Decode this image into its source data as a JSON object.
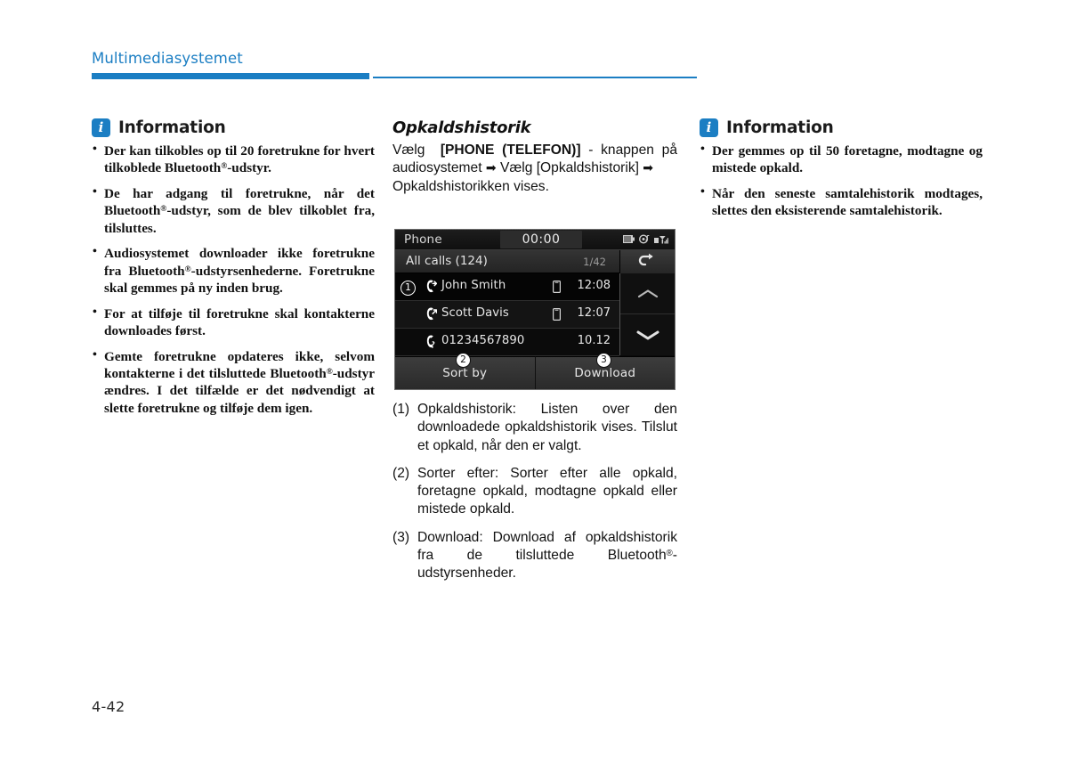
{
  "header": {
    "title": "Multimediasystemet",
    "accent_color": "#1b7ec3"
  },
  "page_number": "4-42",
  "left_column": {
    "info_title": "Information",
    "info_icon": "info-icon",
    "bullets": [
      "Der kan tilkobles op til 20 foretrukne for hvert tilkoblede Bluetooth®-udstyr.",
      "De har adgang til foretrukne, når det Bluetooth®-udstyr, som de blev tilkoblet fra, tilsluttes.",
      "Audiosystemet downloader ikke foretrukne fra Bluetooth®-udstyrsenhederne. Foretrukne skal gemmes på ny inden brug.",
      "For at tilføje til foretrukne skal kontakterne downloades først.",
      "Gemte foretrukne opdateres ikke, selvom kontakterne i det tilsluttede Bluetooth®-udstyr ændres. I det tilfælde er det nødvendigt at slette foretrukne og tilføje dem igen."
    ]
  },
  "middle_column": {
    "section_title": "Opkaldshistorik",
    "intro_line1": "Vælg",
    "intro_button": "[PHONE (TELEFON)]",
    "intro_line2": "- knappen på audiosystemet",
    "arrow": "➡",
    "intro_line3": "Vælg [Opkaldshistorik]",
    "intro_line4": "Opkaldshistorikken vises.",
    "numbered": [
      {
        "label": "(1)",
        "text": "Opkaldshistorik: Listen over den downloadede opkaldshistorik vises. Tilslut et opkald, når den er valgt."
      },
      {
        "label": "(2)",
        "text": "Sorter efter: Sorter efter alle opkald, foretagne opkald, modtagne opkald eller mistede opkald."
      },
      {
        "label": "(3)",
        "text": "Download: Download af opkaldshistorik fra de tilsluttede Bluetooth®-udstyrsenheder."
      }
    ]
  },
  "right_column": {
    "info_title": "Information",
    "info_icon": "info-icon",
    "bullets": [
      "Der gemmes op til 50 foretagne, modtagne og mistede opkald.",
      "Når den seneste samtalehistorik modtages, slettes den eksisterende samtalehistorik."
    ]
  },
  "device_screenshot": {
    "app_name": "Phone",
    "clock": "00:00",
    "status_icons": [
      "battery-icon",
      "audio-icon",
      "signal-icon"
    ],
    "list_title": "All calls (124)",
    "page_index": "1/42",
    "back_icon": "back-arrow-icon",
    "rows": [
      {
        "call_type_icon": "outgoing-call-icon",
        "name": "John Smith",
        "device_icon": "mobile-phone-icon",
        "time": "12:08",
        "selected": true
      },
      {
        "call_type_icon": "outgoing-call-icon",
        "name": "Scott Davis",
        "device_icon": "mobile-phone-icon",
        "time": "12:07",
        "selected": false
      },
      {
        "call_type_icon": "missed-call-icon",
        "name": "01234567890",
        "device_icon": "",
        "time": "10.12",
        "selected": false
      }
    ],
    "scroll_up_icon": "chevron-up-icon",
    "scroll_down_icon": "chevron-down-icon",
    "footer_buttons": [
      {
        "label": "Sort by"
      },
      {
        "label": "Download"
      }
    ],
    "callouts": [
      {
        "number": "❶",
        "style": "dark"
      },
      {
        "number": "❷",
        "style": "light"
      },
      {
        "number": "❸",
        "style": "light"
      }
    ]
  }
}
